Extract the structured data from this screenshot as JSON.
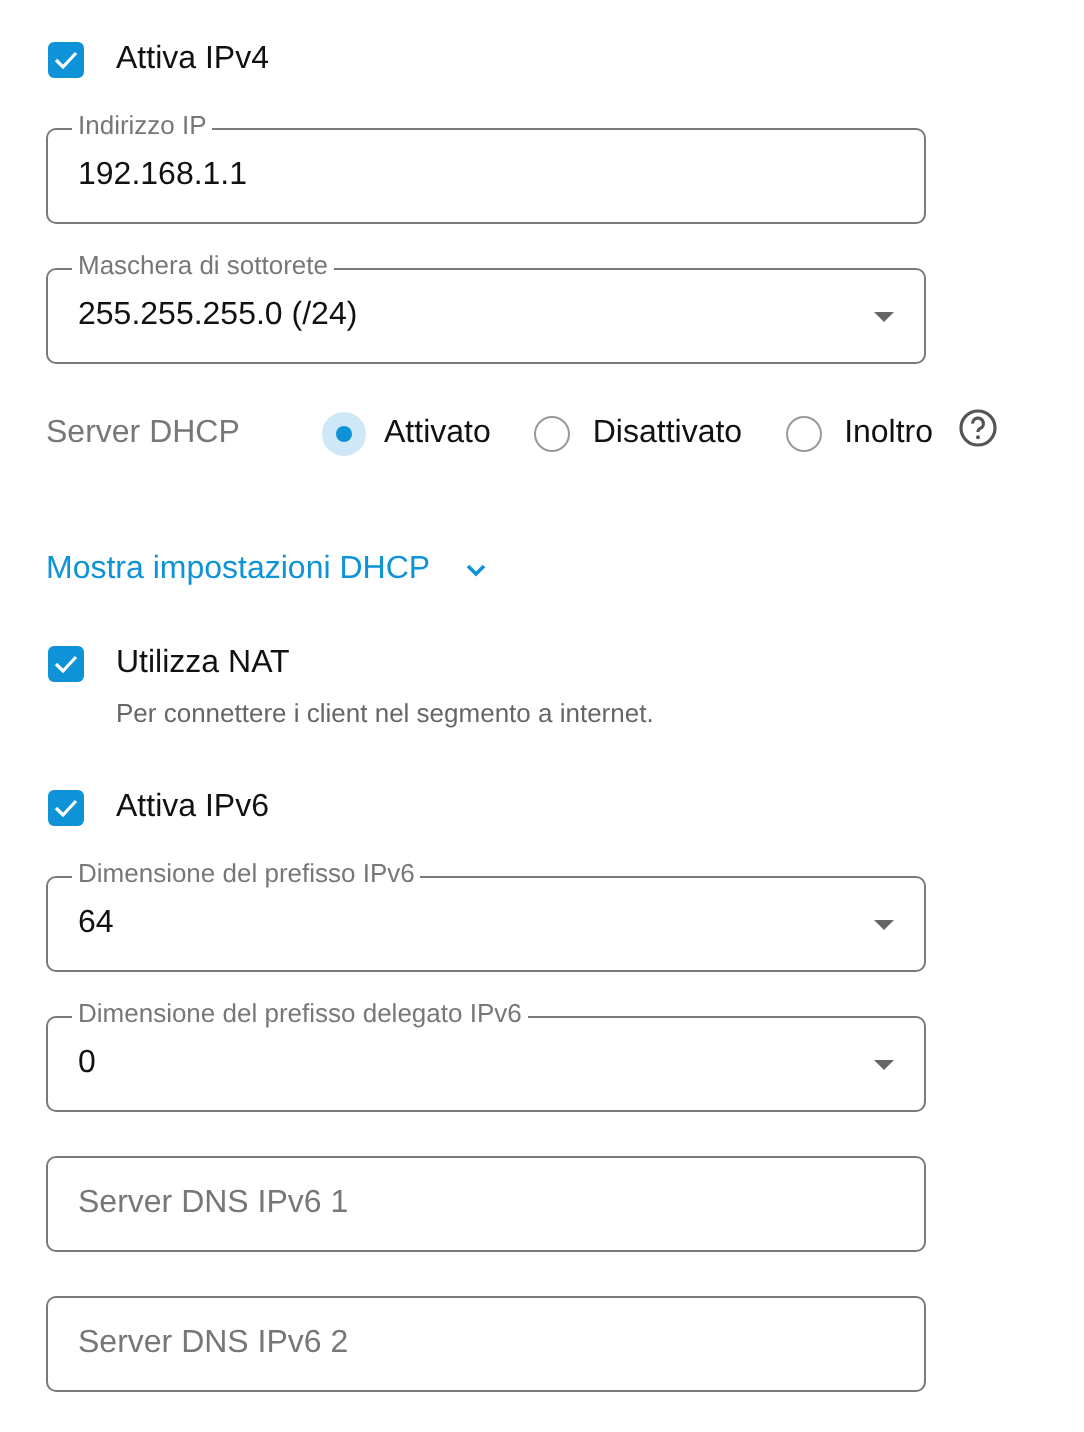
{
  "items": [
    {
      "kind": "checkbox",
      "label": "Attiva IPv4",
      "checked": true
    },
    {
      "kind": "text-field",
      "label": "Indirizzo IP",
      "value": "192.168.1.1"
    },
    {
      "kind": "select",
      "label": "Maschera di sottorete",
      "value": "255.255.255.0 (/24)"
    },
    {
      "kind": "radio-group",
      "label": "Server DHCP",
      "options": [
        {
          "label": "Attivato",
          "selected": true
        },
        {
          "label": "Disattivato",
          "selected": false
        },
        {
          "label": "Inoltro",
          "selected": false
        }
      ],
      "help": true
    },
    {
      "kind": "link",
      "label": "Mostra impostazioni DHCP",
      "expanded": false
    },
    {
      "kind": "checkbox",
      "label": "Utilizza NAT",
      "checked": true,
      "description": "Per connettere i client nel segmento a internet."
    },
    {
      "kind": "checkbox",
      "label": "Attiva IPv6",
      "checked": true
    },
    {
      "kind": "select",
      "label": "Dimensione del prefisso IPv6",
      "value": "64"
    },
    {
      "kind": "select",
      "label": "Dimensione del prefisso delegato IPv6",
      "value": "0"
    },
    {
      "kind": "text-field",
      "placeholder": "Server DNS IPv6 1"
    },
    {
      "kind": "text-field",
      "placeholder": "Server DNS IPv6 2"
    }
  ]
}
